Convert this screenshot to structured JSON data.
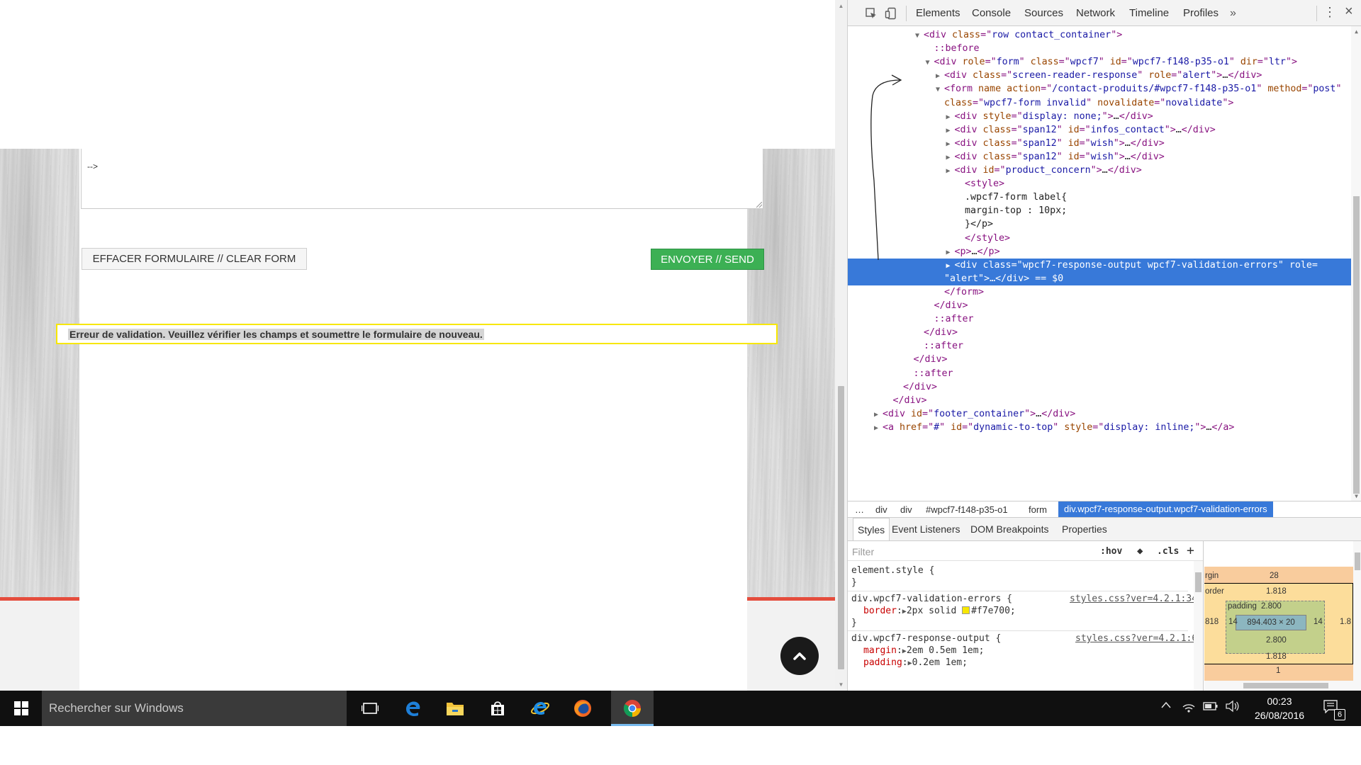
{
  "page": {
    "textarea_text": "-->",
    "clear_button_label": "EFFACER FORMULAIRE // CLEAR FORM",
    "send_button_label": "ENVOYER // SEND",
    "validation_message": "Erreur de validation. Veuillez vérifier les champs et soumettre le formulaire de nouveau."
  },
  "devtools": {
    "tabs": [
      "Elements",
      "Console",
      "Sources",
      "Network",
      "Timeline",
      "Profiles"
    ],
    "more_tabs": "»",
    "menu": "⋮",
    "close": "×",
    "dom_ellipsis": "…",
    "dom_lines": [
      {
        "indent": 6,
        "arrow": "▼",
        "parts": [
          [
            "t",
            "<div "
          ],
          [
            "an",
            "class"
          ],
          [
            "t",
            "=\""
          ],
          [
            "av",
            "row contact_container"
          ],
          [
            "t",
            "\">"
          ]
        ]
      },
      {
        "indent": 7,
        "arrow": "",
        "parts": [
          [
            "t",
            "::before"
          ]
        ]
      },
      {
        "indent": 7,
        "arrow": "▼",
        "parts": [
          [
            "t",
            "<div "
          ],
          [
            "an",
            "role"
          ],
          [
            "t",
            "=\""
          ],
          [
            "av",
            "form"
          ],
          [
            "t",
            "\" "
          ],
          [
            "an",
            "class"
          ],
          [
            "t",
            "=\""
          ],
          [
            "av",
            "wpcf7"
          ],
          [
            "t",
            "\" "
          ],
          [
            "an",
            "id"
          ],
          [
            "t",
            "=\""
          ],
          [
            "av",
            "wpcf7-f148-p35-o1"
          ],
          [
            "t",
            "\" "
          ],
          [
            "an",
            "dir"
          ],
          [
            "t",
            "=\""
          ],
          [
            "av",
            "ltr"
          ],
          [
            "t",
            "\">"
          ]
        ]
      },
      {
        "indent": 8,
        "arrow": "▶",
        "parts": [
          [
            "t",
            "<div "
          ],
          [
            "an",
            "class"
          ],
          [
            "t",
            "=\""
          ],
          [
            "av",
            "screen-reader-response"
          ],
          [
            "t",
            "\" "
          ],
          [
            "an",
            "role"
          ],
          [
            "t",
            "=\""
          ],
          [
            "av",
            "alert"
          ],
          [
            "t",
            "\">"
          ],
          [
            "tx",
            "…"
          ],
          [
            "t",
            "</div>"
          ]
        ]
      },
      {
        "indent": 8,
        "arrow": "▼",
        "parts": [
          [
            "t",
            "<form "
          ],
          [
            "an",
            "name action"
          ],
          [
            "t",
            "=\""
          ],
          [
            "av",
            "/contact-produits/#wpcf7-f148-p35-o1"
          ],
          [
            "t",
            "\" "
          ],
          [
            "an",
            "method"
          ],
          [
            "t",
            "=\""
          ],
          [
            "av",
            "post"
          ],
          [
            "t",
            "\""
          ]
        ]
      },
      {
        "indent": 8,
        "arrow": "",
        "parts": [
          [
            "an",
            "class"
          ],
          [
            "t",
            "=\""
          ],
          [
            "av",
            "wpcf7-form invalid"
          ],
          [
            "t",
            "\" "
          ],
          [
            "an",
            "novalidate"
          ],
          [
            "t",
            "=\""
          ],
          [
            "av",
            "novalidate"
          ],
          [
            "t",
            "\">"
          ]
        ]
      },
      {
        "indent": 9,
        "arrow": "▶",
        "parts": [
          [
            "t",
            "<div "
          ],
          [
            "an",
            "style"
          ],
          [
            "t",
            "=\""
          ],
          [
            "av",
            "display: none;"
          ],
          [
            "t",
            "\">"
          ],
          [
            "tx",
            "…"
          ],
          [
            "t",
            "</div>"
          ]
        ]
      },
      {
        "indent": 9,
        "arrow": "▶",
        "parts": [
          [
            "t",
            "<div "
          ],
          [
            "an",
            "class"
          ],
          [
            "t",
            "=\""
          ],
          [
            "av",
            "span12"
          ],
          [
            "t",
            "\" "
          ],
          [
            "an",
            "id"
          ],
          [
            "t",
            "=\""
          ],
          [
            "av",
            "infos_contact"
          ],
          [
            "t",
            "\">"
          ],
          [
            "tx",
            "…"
          ],
          [
            "t",
            "</div>"
          ]
        ]
      },
      {
        "indent": 9,
        "arrow": "▶",
        "parts": [
          [
            "t",
            "<div "
          ],
          [
            "an",
            "class"
          ],
          [
            "t",
            "=\""
          ],
          [
            "av",
            "span12"
          ],
          [
            "t",
            "\" "
          ],
          [
            "an",
            "id"
          ],
          [
            "t",
            "=\""
          ],
          [
            "av",
            "wish"
          ],
          [
            "t",
            "\">"
          ],
          [
            "tx",
            "…"
          ],
          [
            "t",
            "</div>"
          ]
        ]
      },
      {
        "indent": 9,
        "arrow": "▶",
        "parts": [
          [
            "t",
            "<div "
          ],
          [
            "an",
            "class"
          ],
          [
            "t",
            "=\""
          ],
          [
            "av",
            "span12"
          ],
          [
            "t",
            "\" "
          ],
          [
            "an",
            "id"
          ],
          [
            "t",
            "=\""
          ],
          [
            "av",
            "wish"
          ],
          [
            "t",
            "\">"
          ],
          [
            "tx",
            "…"
          ],
          [
            "t",
            "</div>"
          ]
        ]
      },
      {
        "indent": 9,
        "arrow": "▶",
        "parts": [
          [
            "t",
            "<div "
          ],
          [
            "an",
            "id"
          ],
          [
            "t",
            "=\""
          ],
          [
            "av",
            "product_concern"
          ],
          [
            "t",
            "\">"
          ],
          [
            "tx",
            "…"
          ],
          [
            "t",
            "</div>"
          ]
        ]
      },
      {
        "indent": 10,
        "arrow": "",
        "parts": [
          [
            "t",
            "<style>"
          ]
        ]
      },
      {
        "indent": 10,
        "arrow": "",
        "parts": [
          [
            "tx",
            ".wpcf7-form label{"
          ]
        ]
      },
      {
        "indent": 10,
        "arrow": "",
        "parts": [
          [
            "tx",
            "margin-top : 10px;"
          ]
        ]
      },
      {
        "indent": 10,
        "arrow": "",
        "parts": [
          [
            "tx",
            "}</p>"
          ]
        ]
      },
      {
        "indent": 10,
        "arrow": "",
        "parts": [
          [
            "t",
            "</style>"
          ]
        ]
      },
      {
        "indent": 9,
        "arrow": "▶",
        "parts": [
          [
            "t",
            "<p>"
          ],
          [
            "tx",
            "…"
          ],
          [
            "t",
            "</p>"
          ]
        ]
      },
      {
        "indent": 9,
        "arrow": "▶",
        "sel": true,
        "parts": [
          [
            "t",
            "<div "
          ],
          [
            "an",
            "class"
          ],
          [
            "t",
            "=\""
          ],
          [
            "av",
            "wpcf7-response-output wpcf7-validation-errors"
          ],
          [
            "t",
            "\" "
          ],
          [
            "an",
            "role"
          ],
          [
            "t",
            "="
          ]
        ]
      },
      {
        "indent": 8,
        "arrow": "",
        "sel": true,
        "parts": [
          [
            "av",
            "\"alert\""
          ],
          [
            "t",
            ">"
          ],
          [
            "tx",
            "…"
          ],
          [
            "t",
            "</div>"
          ],
          [
            "tx",
            " == $0"
          ]
        ]
      },
      {
        "indent": 8,
        "arrow": "",
        "parts": [
          [
            "t",
            "</form>"
          ]
        ]
      },
      {
        "indent": 7,
        "arrow": "",
        "parts": [
          [
            "t",
            "</div>"
          ]
        ]
      },
      {
        "indent": 7,
        "arrow": "",
        "parts": [
          [
            "t",
            "::after"
          ]
        ]
      },
      {
        "indent": 6,
        "arrow": "",
        "parts": [
          [
            "t",
            "</div>"
          ]
        ]
      },
      {
        "indent": 6,
        "arrow": "",
        "parts": [
          [
            "t",
            "::after"
          ]
        ]
      },
      {
        "indent": 5,
        "arrow": "",
        "parts": [
          [
            "t",
            "</div>"
          ]
        ]
      },
      {
        "indent": 5,
        "arrow": "",
        "parts": [
          [
            "t",
            "::after"
          ]
        ]
      },
      {
        "indent": 4,
        "arrow": "",
        "parts": [
          [
            "t",
            "</div>"
          ]
        ]
      },
      {
        "indent": 3,
        "arrow": "",
        "parts": [
          [
            "t",
            "</div>"
          ]
        ]
      },
      {
        "indent": 2,
        "arrow": "▶",
        "parts": [
          [
            "t",
            "<div "
          ],
          [
            "an",
            "id"
          ],
          [
            "t",
            "=\""
          ],
          [
            "av",
            "footer_container"
          ],
          [
            "t",
            "\">"
          ],
          [
            "tx",
            "…"
          ],
          [
            "t",
            "</div>"
          ]
        ]
      },
      {
        "indent": 2,
        "arrow": "▶",
        "parts": [
          [
            "t",
            "<a "
          ],
          [
            "an",
            "href"
          ],
          [
            "t",
            "=\""
          ],
          [
            "av",
            "#"
          ],
          [
            "t",
            "\" "
          ],
          [
            "an",
            "id"
          ],
          [
            "t",
            "=\""
          ],
          [
            "av",
            "dynamic-to-top"
          ],
          [
            "t",
            "\" "
          ],
          [
            "an",
            "style"
          ],
          [
            "t",
            "=\""
          ],
          [
            "av",
            "display: inline;"
          ],
          [
            "t",
            "\">"
          ],
          [
            "tx",
            "…"
          ],
          [
            "t",
            "</a>"
          ]
        ]
      }
    ],
    "breadcrumb": [
      "…",
      "div",
      "div",
      "#wpcf7-f148-p35-o1",
      "form"
    ],
    "breadcrumb_selected": "div.wpcf7-response-output.wpcf7-validation-errors",
    "sidebar_tabs": [
      "Styles",
      "Event Listeners",
      "DOM Breakpoints",
      "Properties"
    ],
    "styles": {
      "filter_placeholder": "Filter",
      "hov": ":hov",
      "cls": ".cls",
      "plus": "+",
      "rules": [
        {
          "lines": [
            "element.style {",
            "}"
          ],
          "source": ""
        },
        {
          "selector": "div.wpcf7-validation-errors {",
          "prop": "border",
          "value": "2px solid ",
          "color_value": "#f7e700",
          "close": "}",
          "source": "styles.css?ver=4.2.1:34"
        },
        {
          "selector": "div.wpcf7-response-output {",
          "props": [
            [
              "margin",
              "2em 0.5em 1em;"
            ],
            [
              "padding",
              "0.2em 1em;"
            ]
          ],
          "source": "styles.css?ver=4.2.1:6"
        }
      ]
    },
    "box_model": {
      "margin_label": "rgin",
      "margin_top": "28",
      "border_label": "order",
      "border_top": "1.818",
      "padding_label": "padding",
      "padding_top": "2.800",
      "content": "894.403 × 20",
      "padding_left": "14",
      "padding_right": "14",
      "padding_bottom": "2.800",
      "border_bottom": "1.818",
      "border_left": "818",
      "border_right": "1.8",
      "margin_bottom": "1"
    }
  },
  "taskbar": {
    "search_placeholder": "Rechercher sur Windows",
    "time": "00:23",
    "date": "26/08/2016",
    "notification_count": "6"
  },
  "colors": {
    "validation_border": "#f7e700",
    "send_button": "#3cb054",
    "accent_red": "#e54d3d",
    "selection_blue": "#3879d9"
  }
}
